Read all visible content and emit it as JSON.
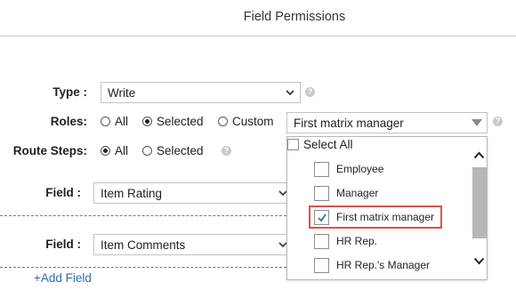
{
  "header": {
    "title": "Field Permissions"
  },
  "form": {
    "type_label": "Type :",
    "type_value": "Write",
    "roles_label": "Roles:",
    "roles_options": [
      "All",
      "Selected",
      "Custom"
    ],
    "roles_selected": "Selected",
    "roles_dropdown_value": "First matrix manager",
    "route_steps_label": "Route Steps:",
    "route_steps_options": [
      "All",
      "Selected"
    ],
    "route_steps_selected": "All",
    "field1_label": "Field :",
    "field1_value": "Item Rating",
    "field2_label": "Field :",
    "field2_value": "Item Comments",
    "add_field_link": "+Add Field",
    "help_glyph": "?"
  },
  "dropdown": {
    "select_all_label": "Select All",
    "options": [
      {
        "label": "Employee",
        "checked": false
      },
      {
        "label": "Manager",
        "checked": false
      },
      {
        "label": "First matrix manager",
        "checked": true
      },
      {
        "label": "HR Rep.",
        "checked": false
      },
      {
        "label": "HR Rep.'s Manager",
        "checked": false
      }
    ]
  },
  "colors": {
    "link": "#2f6ea8",
    "highlight": "#d9534f",
    "check": "#2f6ea8"
  }
}
